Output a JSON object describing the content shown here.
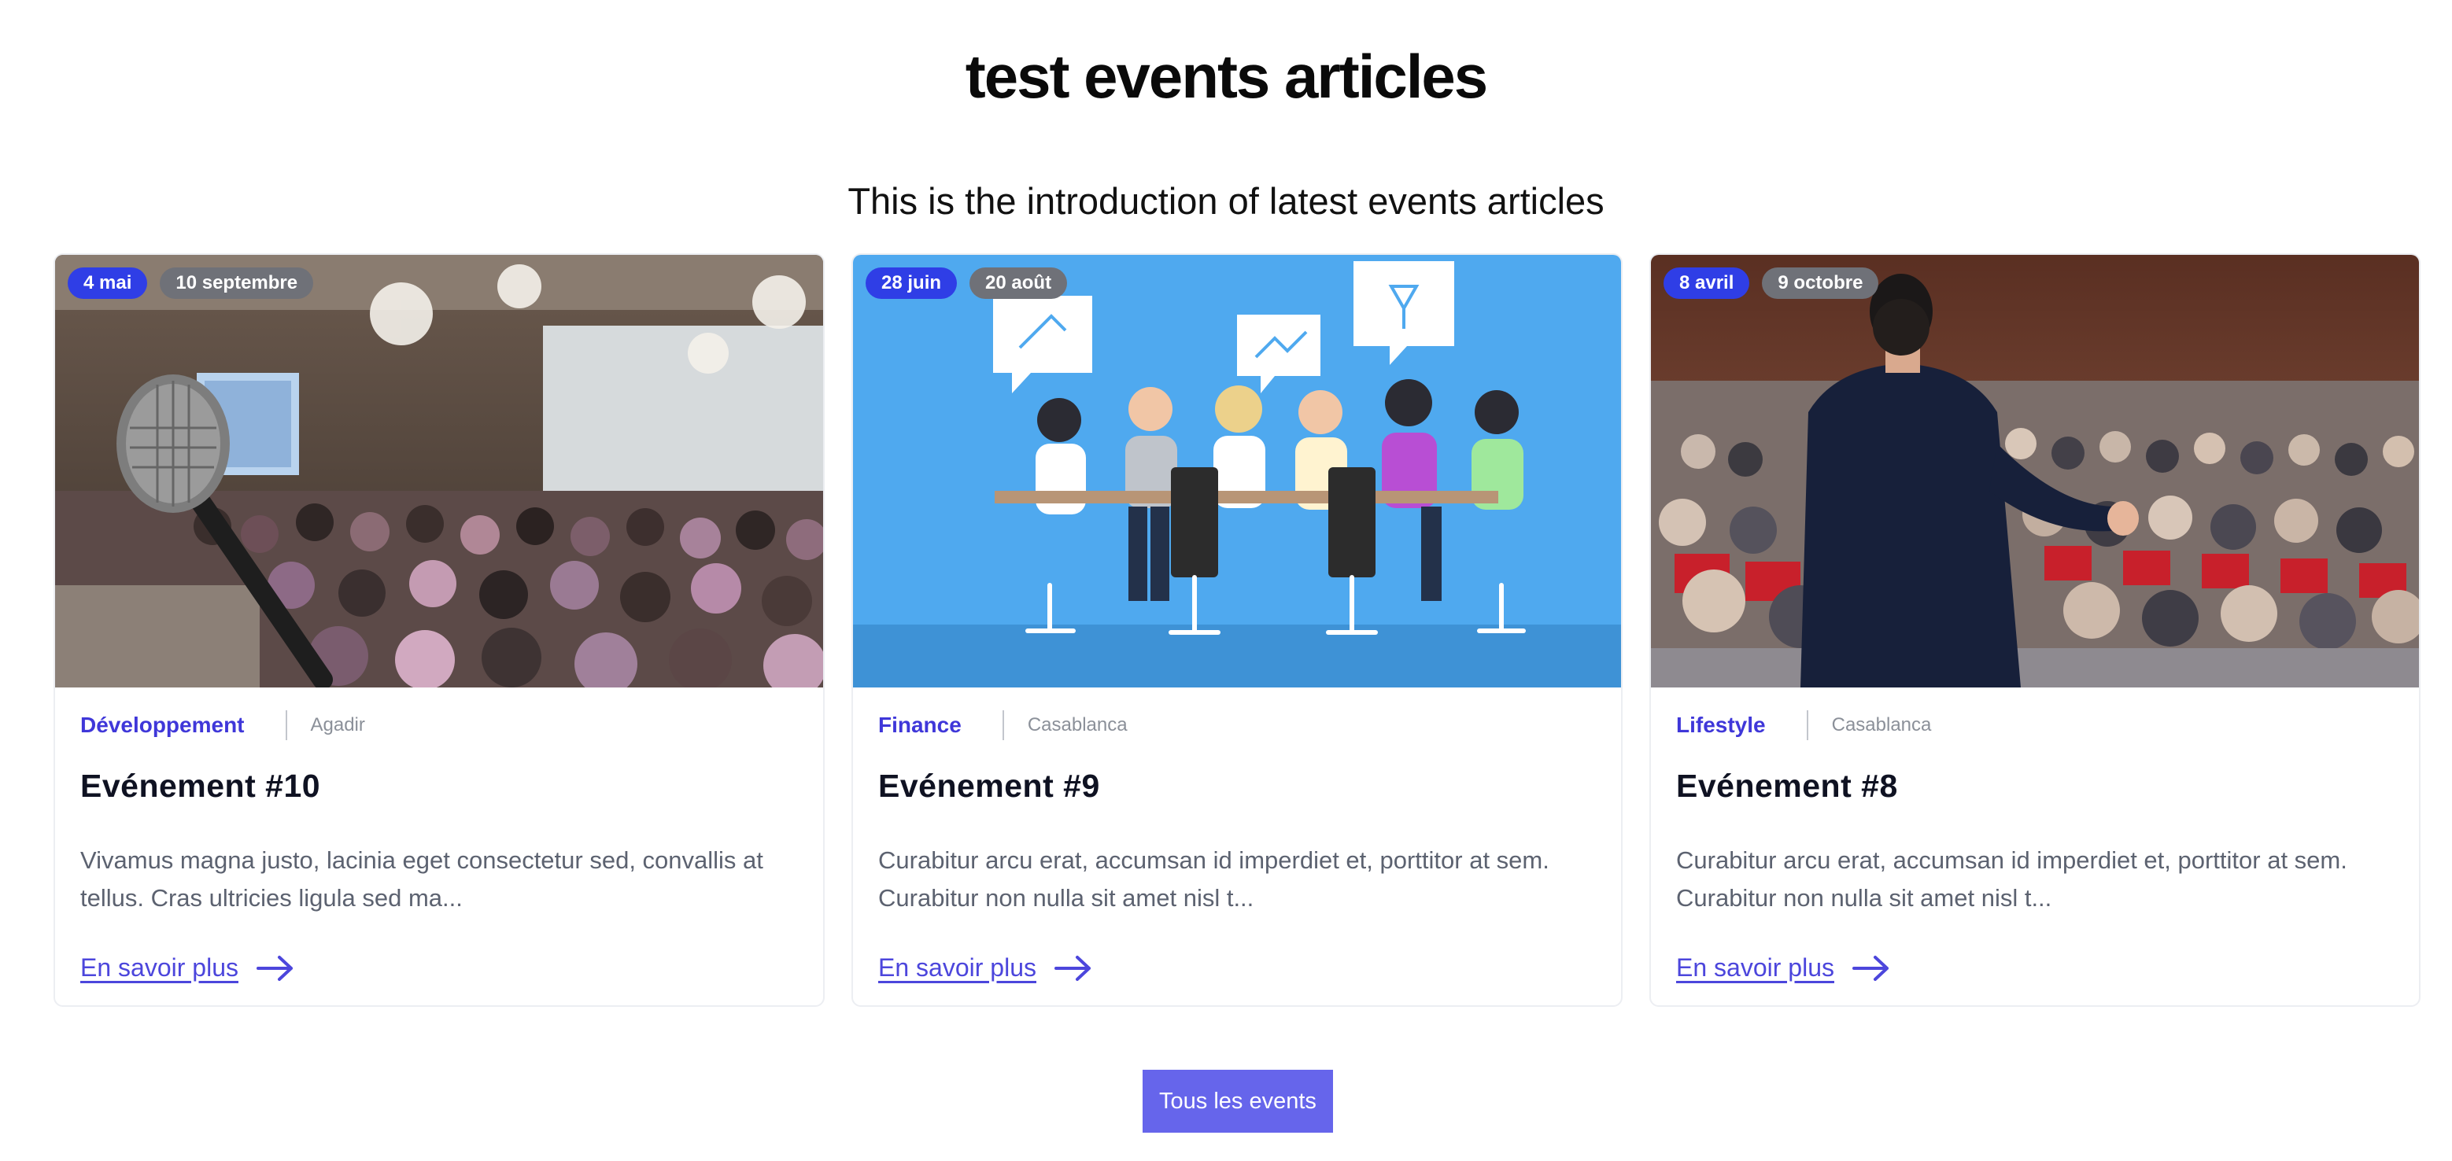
{
  "section": {
    "title": "test events articles",
    "intro": "This is the introduction of latest events articles",
    "button_label": "Tous les events"
  },
  "colors": {
    "accent": "#3f37d9",
    "start_badge": "#2f3ee6",
    "end_badge": "#6f7178",
    "button": "#6665eb"
  },
  "cards": [
    {
      "image": "conference-microphone-photo",
      "start_date": "4 mai",
      "end_date": "10 septembre",
      "category": "Développement",
      "city": "Agadir",
      "title": "Evénement #10",
      "excerpt": "Vivamus magna justo, lacinia eget consectetur sed, convallis at tellus. Cras ultricies ligula sed ma...",
      "link_label": "En savoir plus",
      "link_icon": "arrow-right-icon"
    },
    {
      "image": "team-meeting-illustration",
      "start_date": "28 juin",
      "end_date": "20 août",
      "category": "Finance",
      "city": "Casablanca",
      "title": "Evénement #9",
      "excerpt": "Curabitur arcu erat, accumsan id imperdiet et, porttitor at sem. Curabitur non nulla sit amet nisl t...",
      "link_label": "En savoir plus",
      "link_icon": "arrow-right-icon"
    },
    {
      "image": "speaker-audience-photo",
      "start_date": "8 avril",
      "end_date": "9 octobre",
      "category": "Lifestyle",
      "city": "Casablanca",
      "title": "Evénement #8",
      "excerpt": "Curabitur arcu erat, accumsan id imperdiet et, porttitor at sem. Curabitur non nulla sit amet nisl t...",
      "link_label": "En savoir plus",
      "link_icon": "arrow-right-icon"
    }
  ]
}
